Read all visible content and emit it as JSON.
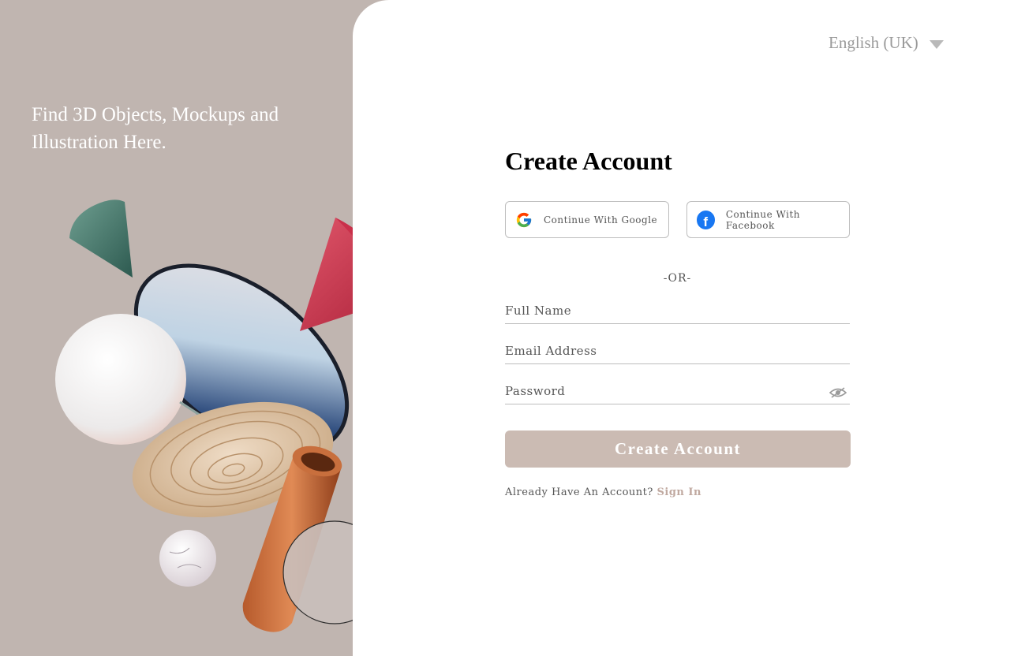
{
  "hero": {
    "tagline": "Find 3D Objects, Mockups and Illustration Here."
  },
  "language": {
    "selected": "English (UK)"
  },
  "form": {
    "title": "Create Account",
    "google_label": "Continue With Google",
    "facebook_label": "Continue With Facebook",
    "separator": "-OR-",
    "full_name_placeholder": "Full Name",
    "email_placeholder": "Email Address",
    "password_placeholder": "Password",
    "submit_label": "Create Account",
    "signin_prompt": "Already Have An Account?",
    "signin_link": "Sign In"
  },
  "icons": {
    "google": "google-icon",
    "facebook": "facebook-icon",
    "eye": "eye-slash-icon",
    "caret": "chevron-down-icon"
  },
  "colors": {
    "left_background": "#c0b5b0",
    "primary_button": "#cbbbb3",
    "link": "#c0a9a0",
    "facebook": "#1877f2"
  }
}
